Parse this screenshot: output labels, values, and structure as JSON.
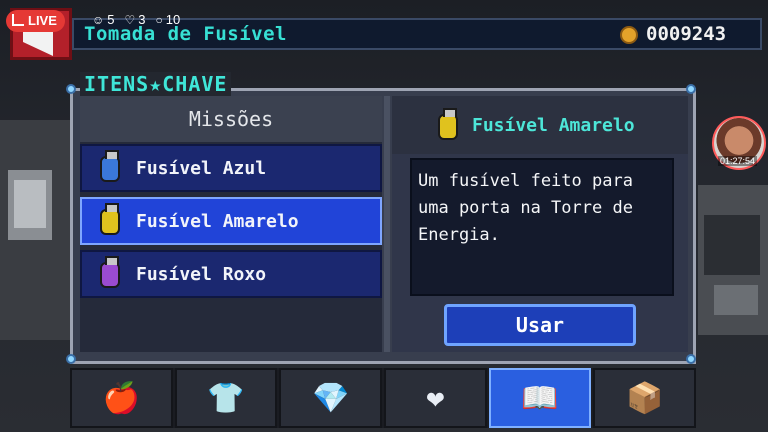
{
  "stream": {
    "live_label": "LIVE",
    "viewers": "5",
    "likes": "3",
    "comments": "10",
    "cam_time": "01:27:54"
  },
  "hud": {
    "quest_title": "Tomada de Fusível",
    "coins": "0009243"
  },
  "panel": {
    "title": "ITENS★CHAVE",
    "section_title": "Missões",
    "items": [
      {
        "label": "Fusível Azul",
        "color": "#3a78d8"
      },
      {
        "label": "Fusível Amarelo",
        "color": "#e0c21e"
      },
      {
        "label": "Fusível Roxo",
        "color": "#9a4bd0"
      }
    ],
    "selected_index": 1
  },
  "detail": {
    "name": "Fusível Amarelo",
    "description": "Um fusível feito para uma porta na Torre de Energia.",
    "use_button": "Usar"
  },
  "tabs": [
    {
      "icon": "food-icon"
    },
    {
      "icon": "armor-icon"
    },
    {
      "icon": "gems-icon"
    },
    {
      "icon": "hearts-icon"
    },
    {
      "icon": "book-icon",
      "active": true
    },
    {
      "icon": "mystery-box-icon"
    }
  ]
}
